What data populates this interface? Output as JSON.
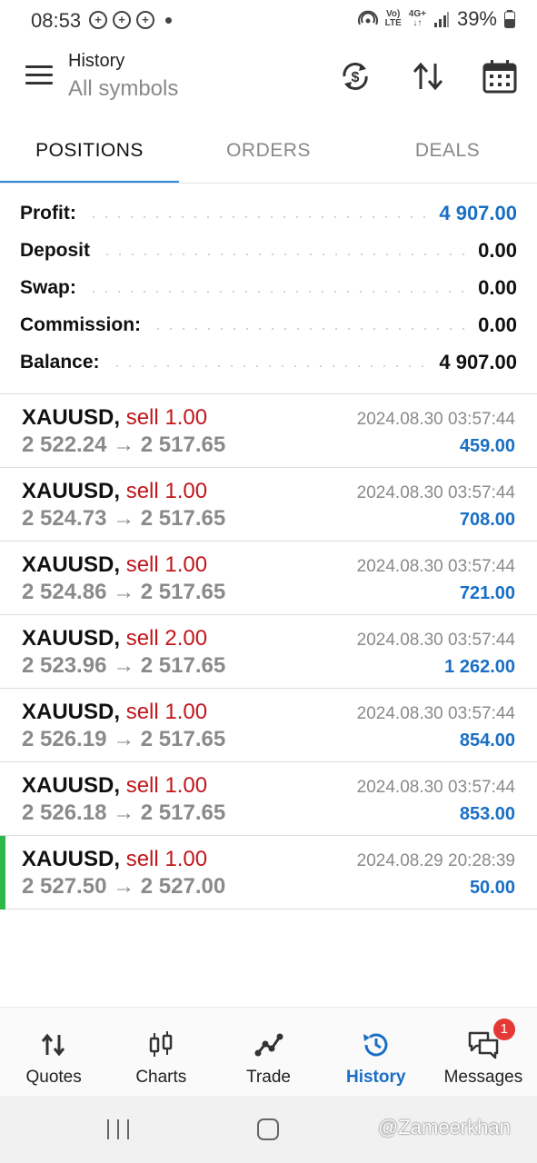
{
  "status_bar": {
    "time": "08:53",
    "net_top": "Vo)",
    "net_bottom": "LTE",
    "net2_top": "4G+",
    "net2_bottom": "↓↑",
    "battery": "39%"
  },
  "header": {
    "title": "History",
    "subtitle": "All symbols",
    "icons": [
      "currency-sync-icon",
      "sort-icon",
      "calendar-icon"
    ]
  },
  "tabs": [
    {
      "label": "POSITIONS",
      "active": true
    },
    {
      "label": "ORDERS",
      "active": false
    },
    {
      "label": "DEALS",
      "active": false
    }
  ],
  "summary": [
    {
      "label": "Profit:",
      "value": "4 907.00",
      "highlight": true
    },
    {
      "label": "Deposit",
      "value": "0.00",
      "highlight": false
    },
    {
      "label": "Swap:",
      "value": "0.00",
      "highlight": false
    },
    {
      "label": "Commission:",
      "value": "0.00",
      "highlight": false
    },
    {
      "label": "Balance:",
      "value": "4 907.00",
      "highlight": false
    }
  ],
  "deals": [
    {
      "symbol": "XAUUSD,",
      "side": "sell 1.00",
      "prices": "2 522.24 → 2 517.65",
      "time": "2024.08.30 03:57:44",
      "profit": "459.00"
    },
    {
      "symbol": "XAUUSD,",
      "side": "sell 1.00",
      "prices": "2 524.73 → 2 517.65",
      "time": "2024.08.30 03:57:44",
      "profit": "708.00"
    },
    {
      "symbol": "XAUUSD,",
      "side": "sell 1.00",
      "prices": "2 524.86 → 2 517.65",
      "time": "2024.08.30 03:57:44",
      "profit": "721.00"
    },
    {
      "symbol": "XAUUSD,",
      "side": "sell 2.00",
      "prices": "2 523.96 → 2 517.65",
      "time": "2024.08.30 03:57:44",
      "profit": "1 262.00"
    },
    {
      "symbol": "XAUUSD,",
      "side": "sell 1.00",
      "prices": "2 526.19 → 2 517.65",
      "time": "2024.08.30 03:57:44",
      "profit": "854.00"
    },
    {
      "symbol": "XAUUSD,",
      "side": "sell 1.00",
      "prices": "2 526.18 → 2 517.65",
      "time": "2024.08.30 03:57:44",
      "profit": "853.00"
    },
    {
      "symbol": "XAUUSD,",
      "side": "sell 1.00",
      "prices": "2 527.50 → 2 527.00",
      "time": "2024.08.29 20:28:39",
      "profit": "50.00"
    }
  ],
  "bottom_nav": [
    {
      "label": "Quotes",
      "icon": "quotes-icon",
      "active": false
    },
    {
      "label": "Charts",
      "icon": "charts-icon",
      "active": false
    },
    {
      "label": "Trade",
      "icon": "trade-icon",
      "active": false
    },
    {
      "label": "History",
      "icon": "history-icon",
      "active": true
    },
    {
      "label": "Messages",
      "icon": "messages-icon",
      "active": false,
      "badge": "1"
    }
  ],
  "watermark": "@Zameerkhan",
  "colors": {
    "accent": "#1a6fc4",
    "tab_underline": "#2e86de",
    "sell": "#c0161b",
    "marker": "#2fb84a",
    "badge": "#e53935"
  }
}
